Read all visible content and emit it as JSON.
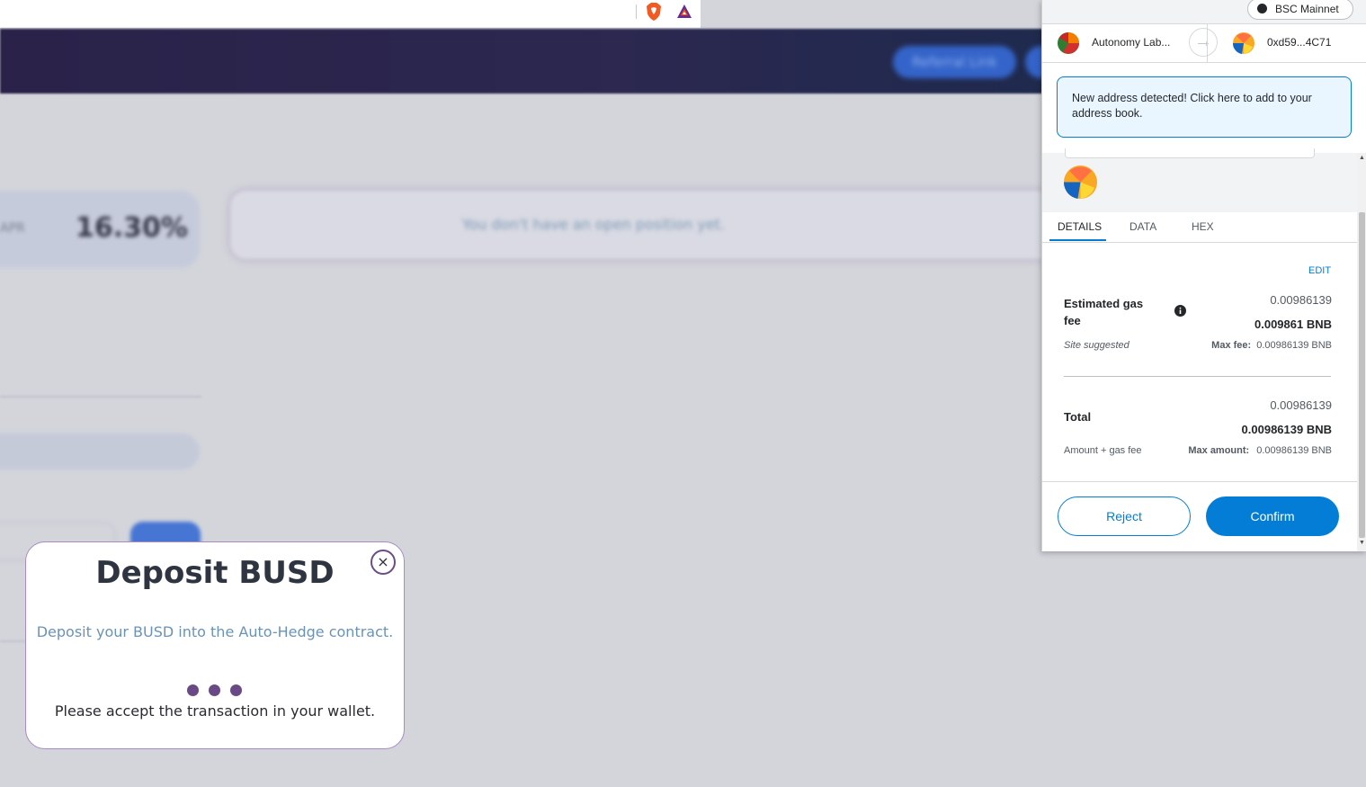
{
  "browser": {
    "extensions": [
      "brave-shields-icon",
      "brave-rewards-icon"
    ]
  },
  "background_app": {
    "referral_label": "Referral Link",
    "apr_label": "APR",
    "apr_value": "16.30%",
    "empty_position_text": "You don't have an open position yet."
  },
  "deposit_modal": {
    "title": "Deposit BUSD",
    "description": "Deposit your BUSD into the Auto-Hedge contract.",
    "status": "Please accept the transaction in your wallet.",
    "close_label": "×",
    "accent_color": "#6a4a84"
  },
  "metamask": {
    "network": "BSC Mainnet",
    "from_account": "Autonomy Lab...",
    "to_account": "0xd59...4C71",
    "notice": "New address detected! Click here to add to your address book.",
    "tabs": [
      "DETAILS",
      "DATA",
      "HEX"
    ],
    "active_tab": "DETAILS",
    "edit_label": "EDIT",
    "gas": {
      "label": "Estimated gas fee",
      "secondary": "0.00986139",
      "primary": "0.009861 BNB",
      "site_suggested": "Site suggested",
      "max_fee_label": "Max fee:",
      "max_fee_value": "0.00986139 BNB"
    },
    "total": {
      "label": "Total",
      "secondary": "0.00986139",
      "primary": "0.00986139 BNB",
      "amount_gas": "Amount + gas fee",
      "max_amount_label": "Max amount:",
      "max_amount_value": "0.00986139 BNB"
    },
    "reject_label": "Reject",
    "confirm_label": "Confirm",
    "accent_color": "#037dd6"
  }
}
